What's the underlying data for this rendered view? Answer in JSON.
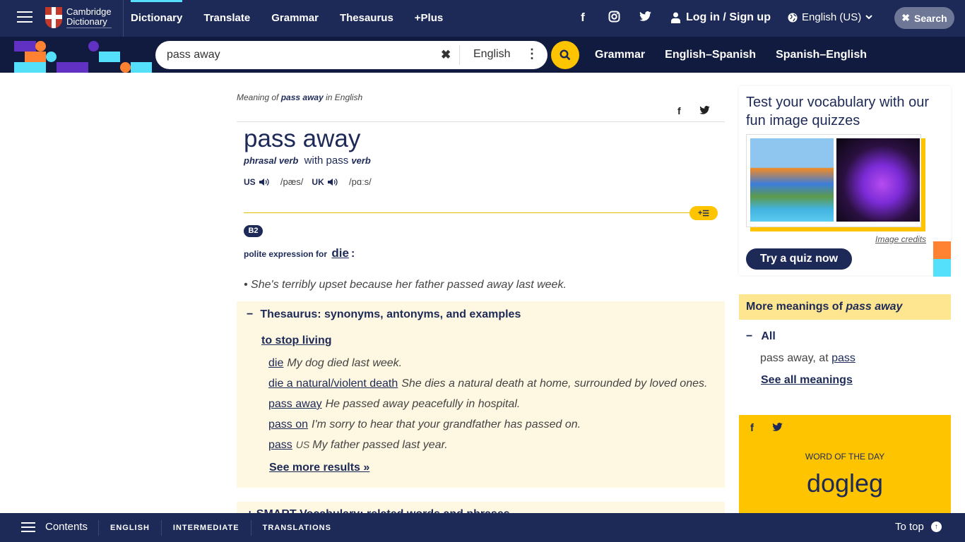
{
  "header": {
    "logo": {
      "line1": "Cambridge",
      "line2": "Dictionary"
    },
    "nav": [
      "Dictionary",
      "Translate",
      "Grammar",
      "Thesaurus",
      "+Plus"
    ],
    "active_nav": "Dictionary",
    "social_icons": [
      "facebook-icon",
      "instagram-icon",
      "twitter-icon"
    ],
    "login_label": "Log in / Sign up",
    "language_label": "English (US)",
    "search_toggle_label": "Search"
  },
  "search": {
    "value": "pass away",
    "dictionary_label": "English",
    "subnav": [
      "Grammar",
      "English–Spanish",
      "Spanish–English"
    ]
  },
  "entry": {
    "meaning_prefix": "Meaning of",
    "meaning_word": "pass away",
    "meaning_suffix": "in English",
    "headword": "pass away",
    "pos": "phrasal verb",
    "with_text": "with pass",
    "with_pos": "verb",
    "us_label": "US",
    "us_ipa": "/pæs/",
    "uk_label": "UK",
    "uk_ipa": "/pɑːs/",
    "level": "B2",
    "definition_prefix": "polite expression for",
    "definition_link": "die",
    "definition_colon": ":",
    "example": "She's terribly upset because her father passed away last week."
  },
  "thesaurus": {
    "title": "Thesaurus: synonyms, antonyms, and examples",
    "subtitle": "to stop living",
    "items": [
      {
        "word": "die",
        "label": "",
        "example": "My dog died last week."
      },
      {
        "word": "die a natural/violent death",
        "label": "",
        "example": "She dies a natural death at home, surrounded by loved ones."
      },
      {
        "word": "pass away",
        "label": "",
        "example": "He passed away peacefully in hospital."
      },
      {
        "word": "pass on",
        "label": "",
        "example": "I'm sorry to hear that your grandfather has passed on."
      },
      {
        "word": "pass",
        "label": "US",
        "example": "My father passed last year."
      }
    ],
    "see_more": "See more results »"
  },
  "smart_vocab": {
    "title": "+ SMART Vocabulary: related words and phrases"
  },
  "sidebar": {
    "quiz": {
      "title": "Test your vocabulary with our fun image quizzes",
      "image_credits": "Image credits",
      "button": "Try a quiz now"
    },
    "more_meanings": {
      "title_prefix": "More meanings of",
      "title_word": "pass away",
      "group": "All",
      "entry_text": "pass away, at",
      "entry_link": "pass",
      "see_all": "See all meanings"
    },
    "word_of_the_day": {
      "label": "WORD OF THE DAY",
      "word": "dogleg"
    }
  },
  "bottombar": {
    "contents": "Contents",
    "tabs": [
      "ENGLISH",
      "INTERMEDIATE",
      "TRANSLATIONS"
    ],
    "to_top": "To top"
  },
  "colors": {
    "navy": "#1d2a57",
    "dark_navy": "#111a3f",
    "yellow": "#fec400",
    "light_yellow": "#fee590",
    "cream": "#fef7e1",
    "cyan": "#54e0fb",
    "orange": "#fe8231",
    "purple": "#6131c4"
  }
}
